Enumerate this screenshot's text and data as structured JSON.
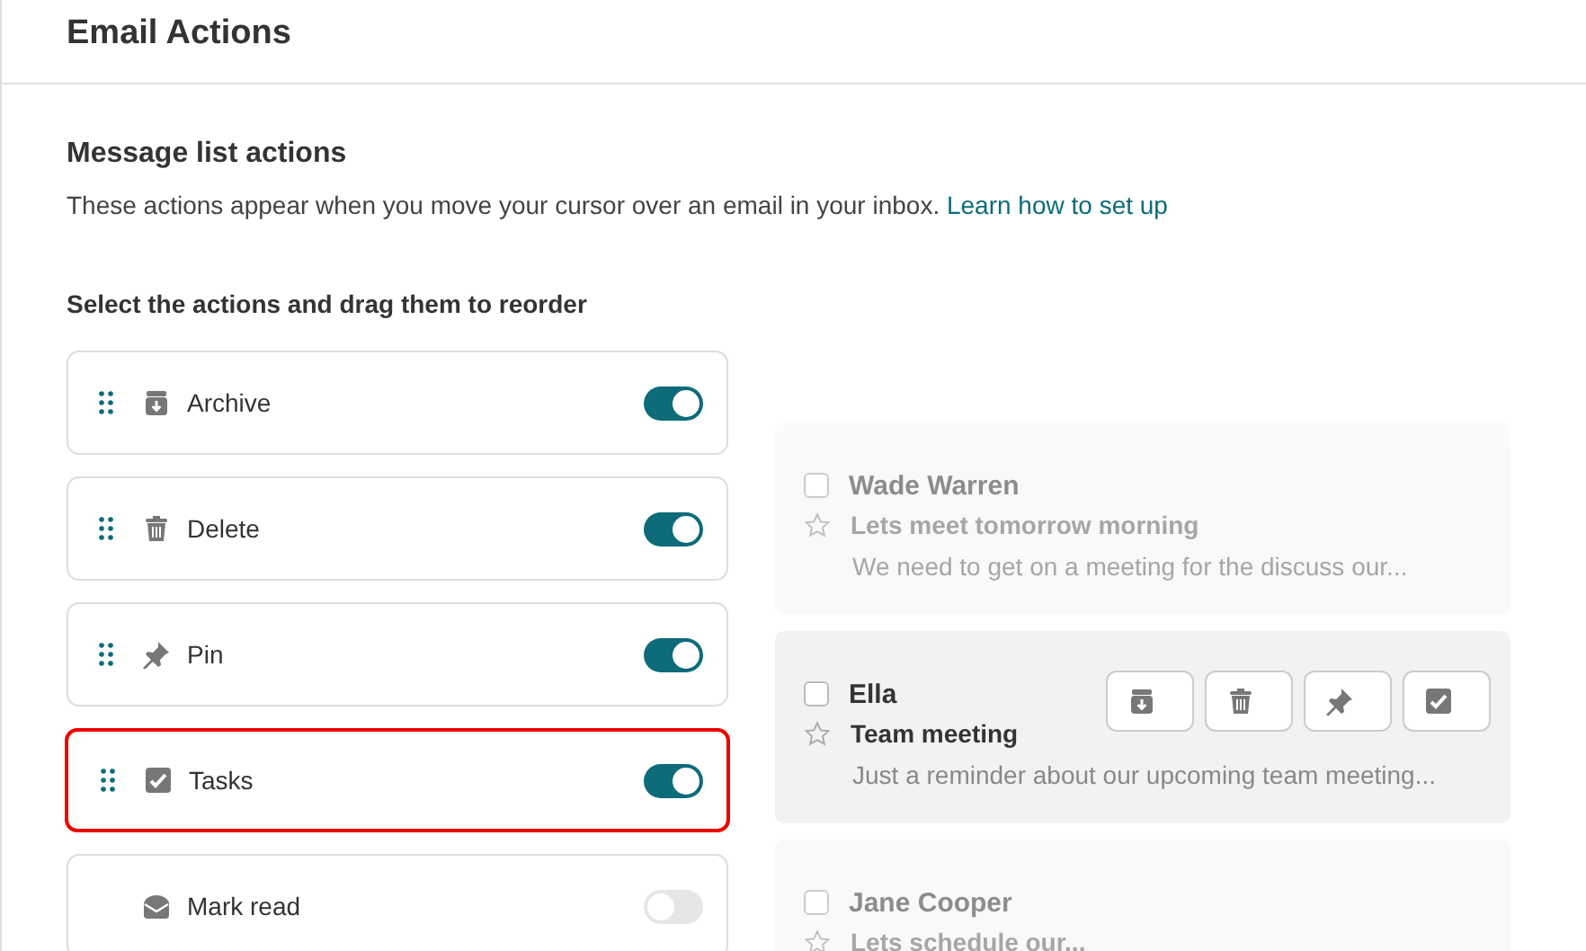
{
  "header": {
    "title": "Email Actions"
  },
  "section": {
    "title": "Message list actions",
    "description": "These actions appear when you move your cursor over an email in your inbox.",
    "link": "Learn how to set up",
    "instruction": "Select the actions and drag them to reorder"
  },
  "actions": [
    {
      "kind": "archive",
      "label": "Archive",
      "on": true,
      "draggable": true,
      "highlighted": false
    },
    {
      "kind": "delete",
      "label": "Delete",
      "on": true,
      "draggable": true,
      "highlighted": false
    },
    {
      "kind": "pin",
      "label": "Pin",
      "on": true,
      "draggable": true,
      "highlighted": false
    },
    {
      "kind": "tasks",
      "label": "Tasks",
      "on": true,
      "draggable": true,
      "highlighted": true
    },
    {
      "kind": "mark_read",
      "label": "Mark read",
      "on": false,
      "draggable": false,
      "highlighted": false
    }
  ],
  "emails": [
    {
      "sender": "Wade Warren",
      "subject": "Lets meet tomorrow morning",
      "preview": "We need to get on a meeting for the discuss our...",
      "hovered": false,
      "checked": false,
      "starred": false
    },
    {
      "sender": "Ella",
      "subject": "Team meeting",
      "preview": "Just a reminder about our upcoming team meeting...",
      "hovered": true,
      "checked": false,
      "starred": false
    },
    {
      "sender": "Jane Cooper",
      "subject": "Lets schedule our...",
      "hovered": false,
      "checked": false,
      "starred": false
    }
  ]
}
